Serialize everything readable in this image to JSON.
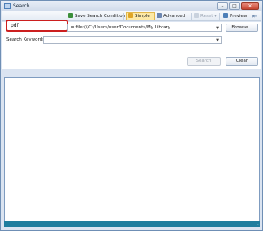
{
  "window": {
    "title": "Search"
  },
  "titlebar": {
    "minimize": "–",
    "maximize": "□",
    "close": "✕"
  },
  "toolbar": {
    "save_condition": "Save Search Condition",
    "save_condition_arrow": "▾",
    "simple": "Simple",
    "advanced": "Advanced",
    "reset": "Reset",
    "reset_arrow": "▾",
    "preview": "Preview",
    "pin": "⇤"
  },
  "filter": {
    "file_type_value": "pdf",
    "path_value": "= file:///C:/Users/user/Documents/My Library",
    "browse_label": "Browse..."
  },
  "keywords": {
    "label": "Search Keywords:",
    "value": ""
  },
  "actions": {
    "search_label": "Search",
    "clear_label": "Clear"
  },
  "colors": {
    "highlight_border": "#cc1f1f",
    "status_bar": "#1f7d9e",
    "selected_tab": "#fde9a6"
  },
  "icons": [
    "app-icon",
    "save-condition-icon",
    "simple-icon",
    "advanced-icon",
    "reset-icon",
    "preview-icon",
    "pin-icon"
  ]
}
